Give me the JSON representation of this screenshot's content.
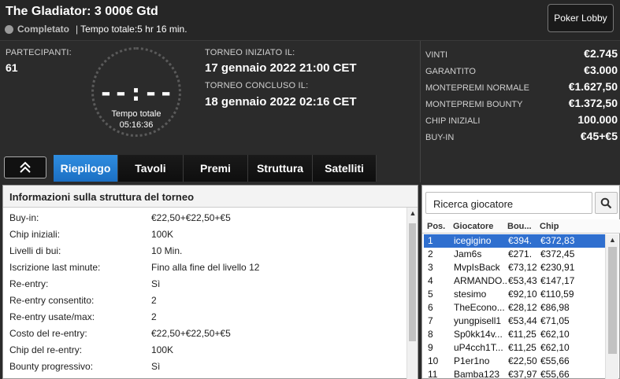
{
  "header": {
    "title": "The Gladiator: 3 000€ Gtd",
    "status": "Completato",
    "separator": "|",
    "total_time": "Tempo totale:5 hr 16 min.",
    "lobby_button": "Poker Lobby"
  },
  "overview": {
    "participants_label": "PARTECIPANTI:",
    "participants_value": "61",
    "clock_digits": "--:--",
    "clock_label": "Tempo totale",
    "clock_time": "05:16:36",
    "start_label": "TORNEO INIZIATO IL:",
    "start_value": "17 gennaio 2022  21:00 CET",
    "end_label": "TORNEO CONCLUSO IL:",
    "end_value": "18 gennaio 2022  02:16 CET"
  },
  "stats": [
    {
      "label": "VINTI",
      "value": "€2.745"
    },
    {
      "label": "GARANTITO",
      "value": "€3.000"
    },
    {
      "label": "MONTEPREMI NORMALE",
      "value": "€1.627,50"
    },
    {
      "label": "MONTEPREMI BOUNTY",
      "value": "€1.372,50"
    },
    {
      "label": "CHIP INIZIALI",
      "value": "100.000"
    },
    {
      "label": "BUY-IN",
      "value": "€45+€5"
    }
  ],
  "tabs": [
    "Riepilogo",
    "Tavoli",
    "Premi",
    "Struttura",
    "Satelliti"
  ],
  "active_tab": "Riepilogo",
  "details": {
    "title": "Informazioni sulla struttura del torneo",
    "rows": [
      {
        "label": "Buy-in:",
        "value": "€22,50+€22,50+€5"
      },
      {
        "label": "Chip iniziali:",
        "value": "100K"
      },
      {
        "label": "Livelli di bui:",
        "value": "10 Min."
      },
      {
        "label": "Iscrizione last minute:",
        "value": "Fino alla fine del livello 12"
      },
      {
        "label": "Re-entry:",
        "value": "Sì"
      },
      {
        "label": "Re-entry consentito:",
        "value": "2"
      },
      {
        "label": "Re-entry usate/max:",
        "value": "2"
      },
      {
        "label": "Costo del re-entry:",
        "value": "€22,50+€22,50+€5"
      },
      {
        "label": "Chip del re-entry:",
        "value": "100K"
      },
      {
        "label": "Bounty progressivo:",
        "value": "Sì"
      }
    ]
  },
  "players": {
    "search_placeholder": "Ricerca giocatore",
    "columns": [
      "Pos.",
      "Giocatore",
      "Bou...",
      "Chip"
    ],
    "rows": [
      {
        "pos": "1",
        "name": "icegigino",
        "bounty": "€394.",
        "chip": "€372,83",
        "selected": true
      },
      {
        "pos": "2",
        "name": "Jam6s",
        "bounty": "€271.",
        "chip": "€372,45"
      },
      {
        "pos": "3",
        "name": "MvpIsBack",
        "bounty": "€73,12",
        "chip": "€230,91"
      },
      {
        "pos": "4",
        "name": "ARMANDO..",
        "bounty": "€53,43",
        "chip": "€147,17"
      },
      {
        "pos": "5",
        "name": "stesimo",
        "bounty": "€92,10",
        "chip": "€110,59"
      },
      {
        "pos": "6",
        "name": "TheEcono...",
        "bounty": "€28,12",
        "chip": "€86,98"
      },
      {
        "pos": "7",
        "name": "yungpisell1",
        "bounty": "€53,44",
        "chip": "€71,05"
      },
      {
        "pos": "8",
        "name": "Sp0kk14v...",
        "bounty": "€11,25",
        "chip": "€62,10"
      },
      {
        "pos": "9",
        "name": "uP4cch1T...",
        "bounty": "€11,25",
        "chip": "€62,10"
      },
      {
        "pos": "10",
        "name": "P1er1no",
        "bounty": "€22,50",
        "chip": "€55,66"
      },
      {
        "pos": "11",
        "name": "Bamba123",
        "bounty": "€37,97",
        "chip": "€55,66"
      }
    ]
  }
}
